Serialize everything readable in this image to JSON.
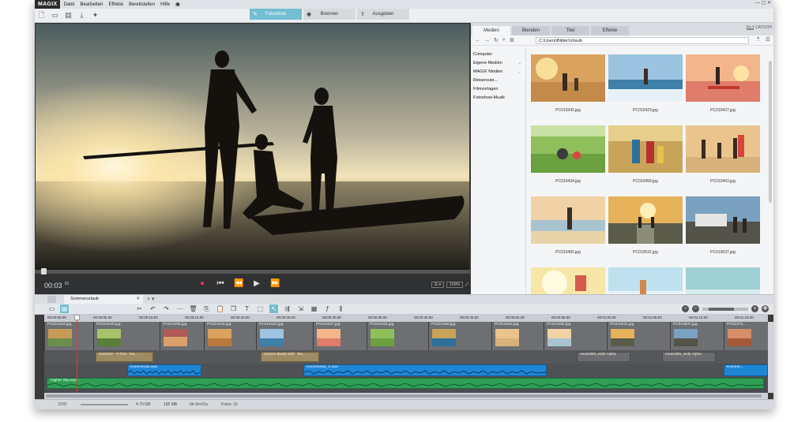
{
  "app": {
    "logo": "MAGIX"
  },
  "menu": [
    "Datei",
    "Bearbeiten",
    "Effekte",
    "Bereitstellen",
    "Hilfe"
  ],
  "modes": [
    {
      "label": "Fotoshow",
      "icon": "pencil-icon",
      "active": true
    },
    {
      "label": "Brennen",
      "icon": "disc-icon",
      "active": false
    },
    {
      "label": "Ausgeben",
      "icon": "upload-icon",
      "active": false
    }
  ],
  "preview": {
    "timecode": "00:03",
    "timecode_frames": "10",
    "zoom": "100%"
  },
  "browser": {
    "tabs": [
      "Medien",
      "Blenden",
      "Titel",
      "Effekte"
    ],
    "active_tab": "Medien",
    "catooh": "CATOOH",
    "path": "C:\\Users\\Bilder\\Urlaub",
    "tree": [
      {
        "label": "Computer",
        "expandable": false
      },
      {
        "label": "Eigene Medien",
        "expandable": true
      },
      {
        "label": "MAGIX Medien",
        "expandable": true
      },
      {
        "label": "Reiseroute...",
        "expandable": false
      },
      {
        "label": "Filmvorlagen",
        "expandable": false
      },
      {
        "label": "Fotoshow-Musik",
        "expandable": false
      }
    ],
    "files": [
      "PC010342.jpg",
      "PC010423.jpg",
      "PC010427.jpg",
      "PC010434.jpg",
      "PC010458.jpg",
      "PC010463.jpg",
      "PC010482.jpg",
      "PC010531.jpg",
      "PC010637.jpg",
      "",
      "",
      ""
    ]
  },
  "timeline": {
    "tab": "Sommerurlaub",
    "ruler": [
      "00:00:00.00",
      "00:00:05.00",
      "00:00:10.00",
      "00:00:15.00",
      "00:00:20.00",
      "00:00:25.00",
      "00:00:30.00",
      "00:00:35.00",
      "00:00:40.00",
      "00:00:45.00",
      "00:00:50.00",
      "00:00:55.00",
      "00:01:00.00",
      "00:01:05.00",
      "00:01:10.00",
      "00:01:15.00"
    ],
    "photo_clips": [
      "PC010154.jpg",
      "PC010249.jpg",
      "PC010255.jpg",
      "PC010342.jpg",
      "PC010423.jpg",
      "PC010427.jpg",
      "PC010434.jpg",
      "PC010458.jpg",
      "PC010463.jpg",
      "PC010482.jpg",
      "PC010531.jpg",
      "PC010637.jpg",
      "PC01074..."
    ],
    "title_clips": [
      "Sommer · Y-Pos · Ra...",
      "Unsere Beste Zeit · Ra...",
      "neutral05_wide Alpha",
      "neutral05_wide Alpha"
    ],
    "audio_clips": [
      "Kommentar.wav",
      "Kommentar_2.wav",
      "Komme..."
    ],
    "music_clip": "Higher Sky.mp3"
  },
  "status": {
    "medium": "DVD",
    "capacity": "4.70 GB",
    "size": "195 MB",
    "duration": "0h:2m:51s",
    "photos": "Fotos: 16"
  },
  "colors": {
    "accent": "#73bfd1",
    "audio": "#1f86d6",
    "music": "#2f9e57",
    "title": "#9c8a63",
    "record": "#e3344a"
  }
}
